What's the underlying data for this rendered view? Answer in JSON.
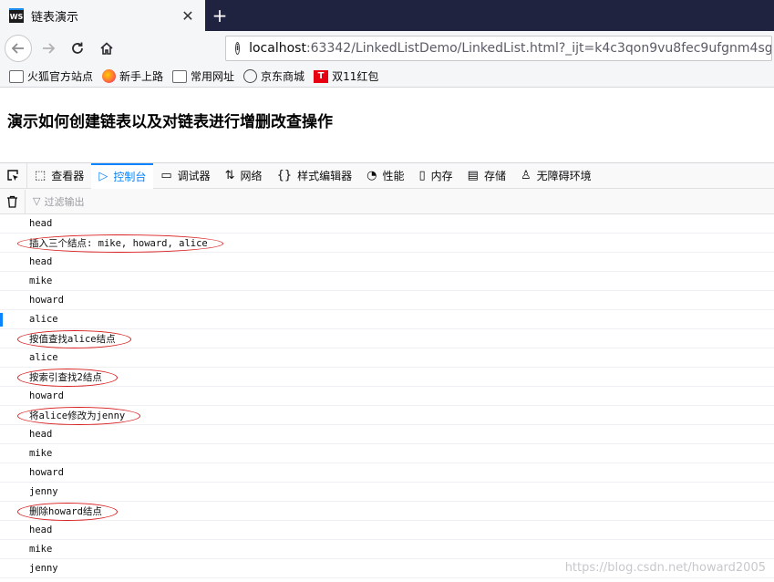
{
  "browser": {
    "tab_title": "链表演示",
    "tab_icon_text": "WS",
    "close_glyph": "✕",
    "new_tab_glyph": "+",
    "url_host": "localhost",
    "url_rest": ":63342/LinkedListDemo/LinkedList.html?_ijt=k4c3qon9vu8fec9ufgnm4sg4v",
    "icons": {
      "back": "arrow-left-icon",
      "forward": "arrow-right-icon",
      "reload": "reload-icon",
      "home": "home-icon",
      "info": "info-icon"
    }
  },
  "bookmarks": [
    {
      "label": "火狐官方站点",
      "icon": "folder-icon"
    },
    {
      "label": "新手上路",
      "icon": "firefox-icon"
    },
    {
      "label": "常用网址",
      "icon": "folder-icon"
    },
    {
      "label": "京东商城",
      "icon": "globe-icon"
    },
    {
      "label": "双11红包",
      "icon": "t-icon"
    }
  ],
  "page": {
    "heading": "演示如何创建链表以及对链表进行增删改查操作"
  },
  "devtools": {
    "tabs": [
      {
        "label": "查看器",
        "icon": "inspector-icon",
        "glyph": "⬚",
        "selected": false
      },
      {
        "label": "控制台",
        "icon": "console-icon",
        "glyph": "▷",
        "selected": true
      },
      {
        "label": "调试器",
        "icon": "debugger-icon",
        "glyph": "▭",
        "selected": false
      },
      {
        "label": "网络",
        "icon": "network-icon",
        "glyph": "⇅",
        "selected": false
      },
      {
        "label": "样式编辑器",
        "icon": "style-editor-icon",
        "glyph": "{}",
        "selected": false
      },
      {
        "label": "性能",
        "icon": "performance-icon",
        "glyph": "◔",
        "selected": false
      },
      {
        "label": "内存",
        "icon": "memory-icon",
        "glyph": "▯",
        "selected": false
      },
      {
        "label": "存储",
        "icon": "storage-icon",
        "glyph": "▤",
        "selected": false
      },
      {
        "label": "无障碍环境",
        "icon": "accessibility-icon",
        "glyph": "♙",
        "selected": false
      }
    ],
    "filter_placeholder": "过滤输出"
  },
  "console": {
    "rows": [
      {
        "text": "head",
        "annotated": false,
        "marked": false
      },
      {
        "text": "插入三个结点: mike, howard, alice",
        "annotated": true,
        "marked": false
      },
      {
        "text": "head",
        "annotated": false,
        "marked": false
      },
      {
        "text": "mike",
        "annotated": false,
        "marked": false
      },
      {
        "text": "howard",
        "annotated": false,
        "marked": false
      },
      {
        "text": "alice",
        "annotated": false,
        "marked": true
      },
      {
        "text": "按值查找alice结点",
        "annotated": true,
        "marked": false
      },
      {
        "text": "alice",
        "annotated": false,
        "marked": false
      },
      {
        "text": "按索引查找2结点",
        "annotated": true,
        "marked": false
      },
      {
        "text": "howard",
        "annotated": false,
        "marked": false
      },
      {
        "text": "将alice修改为jenny",
        "annotated": true,
        "marked": false
      },
      {
        "text": "head",
        "annotated": false,
        "marked": false
      },
      {
        "text": "mike",
        "annotated": false,
        "marked": false
      },
      {
        "text": "howard",
        "annotated": false,
        "marked": false
      },
      {
        "text": "jenny",
        "annotated": false,
        "marked": false
      },
      {
        "text": "删除howard结点",
        "annotated": true,
        "marked": false
      },
      {
        "text": "head",
        "annotated": false,
        "marked": false
      },
      {
        "text": "mike",
        "annotated": false,
        "marked": false
      },
      {
        "text": "jenny",
        "annotated": false,
        "marked": false
      }
    ],
    "annotation_color": "#d81e1e"
  },
  "watermark": "https://blog.csdn.net/howard2005"
}
